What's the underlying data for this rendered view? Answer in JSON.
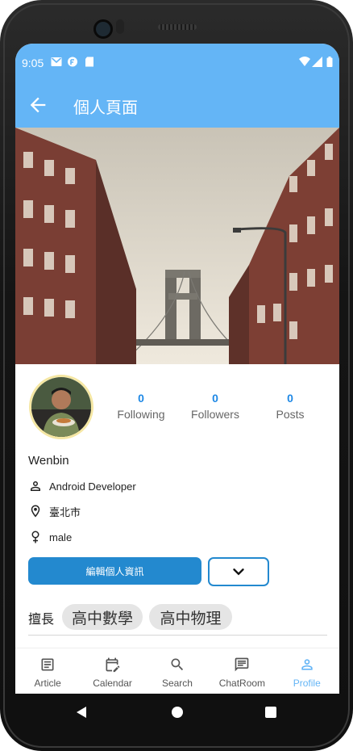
{
  "status_bar": {
    "time": "9:05"
  },
  "app_bar": {
    "title": "個人頁面"
  },
  "profile": {
    "stats": [
      {
        "value": "0",
        "label": "Following"
      },
      {
        "value": "0",
        "label": "Followers"
      },
      {
        "value": "0",
        "label": "Posts"
      }
    ],
    "name": "Wenbin",
    "job": "Android Developer",
    "location": "臺北市",
    "gender": "male",
    "edit_button": "編輯個人資訊",
    "skills_label": "擅長",
    "skills": [
      "高中數學",
      "高中物理"
    ]
  },
  "bottom_nav": {
    "items": [
      {
        "label": "Article",
        "icon": "article-icon"
      },
      {
        "label": "Calendar",
        "icon": "calendar-edit-icon"
      },
      {
        "label": "Search",
        "icon": "search-icon"
      },
      {
        "label": "ChatRoom",
        "icon": "chat-icon"
      },
      {
        "label": "Profile",
        "icon": "person-icon"
      }
    ],
    "active": "Profile"
  },
  "colors": {
    "primary": "#64b5f6",
    "accent": "#2389cf",
    "link": "#1e88e5"
  }
}
